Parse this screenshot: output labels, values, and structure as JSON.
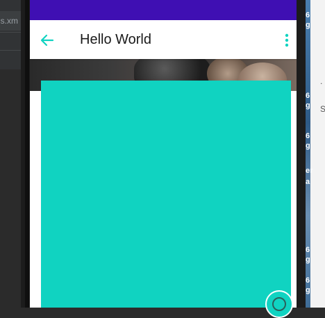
{
  "ide": {
    "file_tab_label": "s.xm"
  },
  "app": {
    "title": "Hello World"
  },
  "right_strip": {
    "snippets": [
      "6",
      "g",
      "6",
      "g",
      "6",
      "g",
      "er",
      "a",
      "6",
      "g",
      "6",
      "g"
    ],
    "marks": [
      ".",
      "S"
    ]
  },
  "colors": {
    "status_bar": "#3f0fb3",
    "accent": "#10d3c1",
    "app_bar": "#ffffff"
  },
  "icons": {
    "back": "arrow-back-icon",
    "overflow": "more-vert-icon",
    "fab": "circle-icon"
  }
}
